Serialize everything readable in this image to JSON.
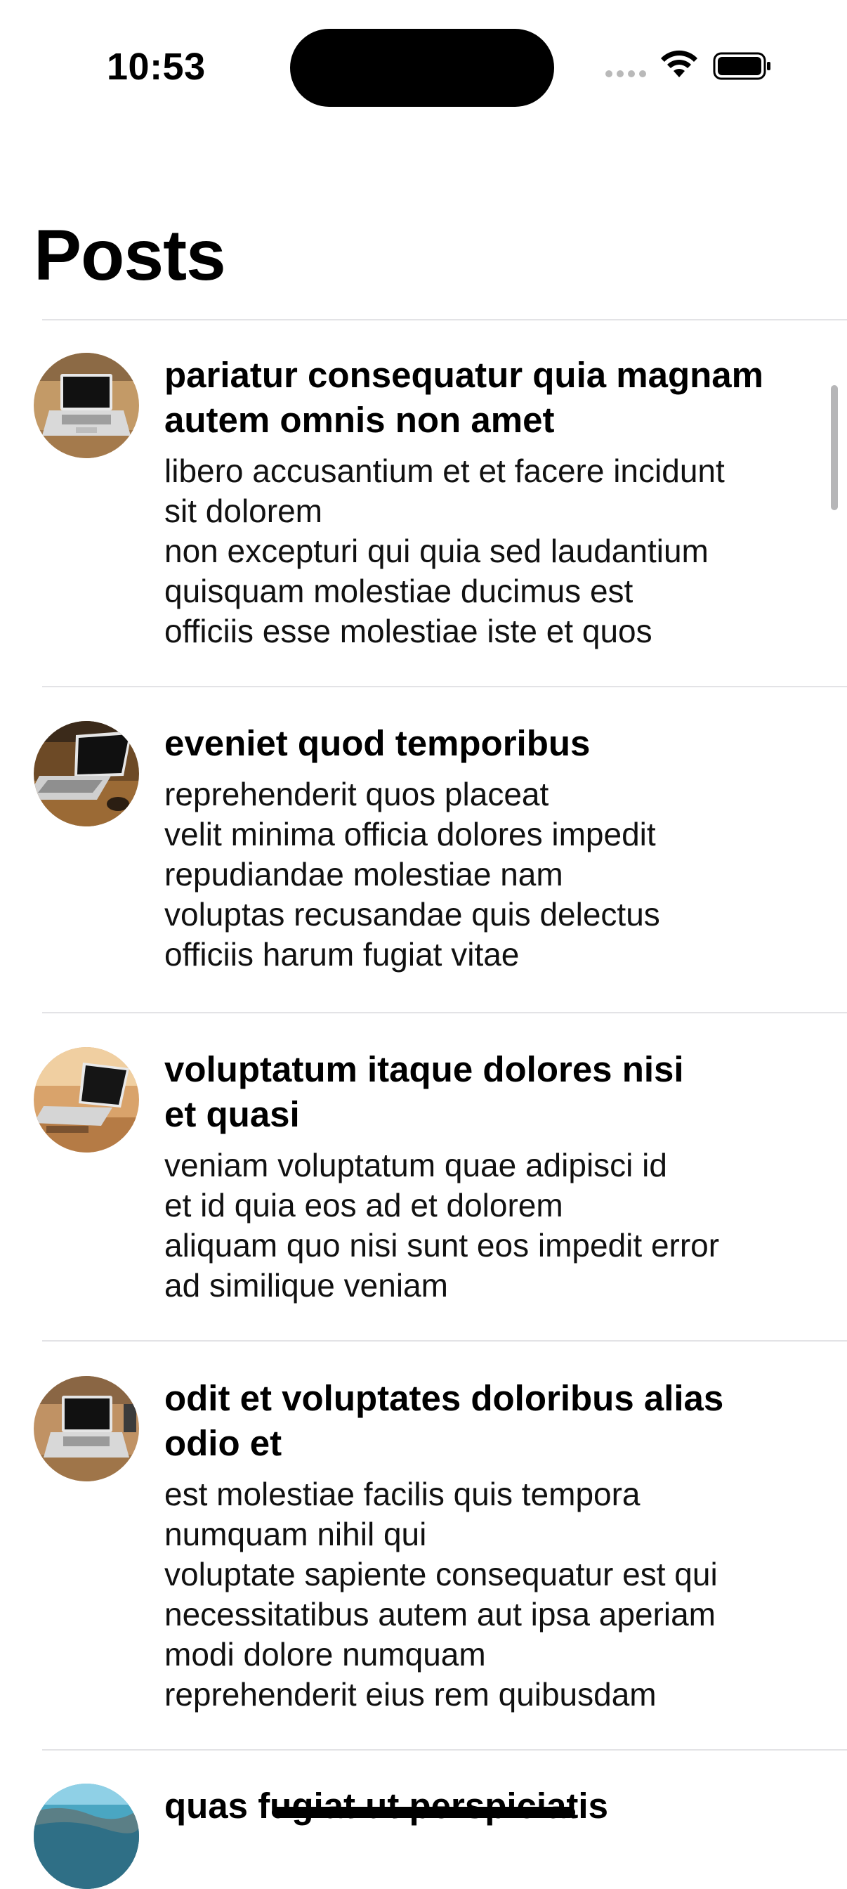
{
  "status_bar": {
    "time": "10:53"
  },
  "page": {
    "title": "Posts"
  },
  "posts": [
    {
      "title": "pariatur consequatur quia magnam\nautem omnis non amet",
      "body": "libero accusantium et et facere incidunt\nsit dolorem\nnon excepturi qui quia sed laudantium\nquisquam molestiae ducimus est\nofficiis esse molestiae iste et quos",
      "avatar": "laptop-on-desk-photo"
    },
    {
      "title": "eveniet quod temporibus",
      "body": "reprehenderit quos placeat\nvelit minima officia dolores impedit\nrepudiandae molestiae nam\nvoluptas recusandae quis delectus\nofficiis harum fugiat vitae",
      "avatar": "laptop-on-wood-table-photo"
    },
    {
      "title": "voluptatum itaque dolores nisi\net quasi",
      "body": "veniam voluptatum quae adipisci id\net id quia eos ad et dolorem\naliquam quo nisi sunt eos impedit error\nad similique veniam",
      "avatar": "laptop-warm-light-photo"
    },
    {
      "title": "odit et voluptates doloribus alias\nodio et",
      "body": "est molestiae facilis quis tempora\nnumquam nihil qui\nvoluptate sapiente consequatur est qui\nnecessitatibus autem aut ipsa aperiam\nmodi dolore numquam\nreprehenderit eius rem quibusdam",
      "avatar": "laptop-on-desk-photo"
    },
    {
      "title": "quas fugiat ut perspiciatis",
      "body": "",
      "avatar": "coastline-photo"
    }
  ]
}
